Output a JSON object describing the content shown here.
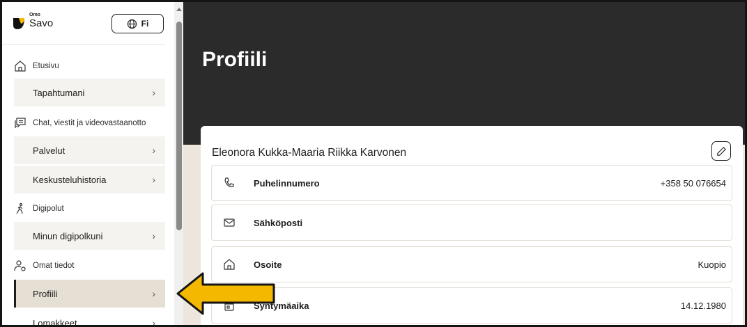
{
  "logo": {
    "small": "Omo",
    "main": "Savo"
  },
  "language_button": {
    "label": "Fi"
  },
  "sidebar": {
    "sections": [
      {
        "label": "Etusivu",
        "icon": "home-icon"
      },
      {
        "label": "Chat, viestit ja videovastaanotto",
        "icon": "chat-icon"
      },
      {
        "label": "Digipolut",
        "icon": "walking-person-icon"
      },
      {
        "label": "Omat tiedot",
        "icon": "user-settings-icon"
      }
    ],
    "items": [
      {
        "label": "Tapahtumani",
        "chevron": "›"
      },
      {
        "label": "Palvelut",
        "chevron": "›"
      },
      {
        "label": "Keskusteluhistoria",
        "chevron": "›"
      },
      {
        "label": "Minun digipolkuni",
        "chevron": "›"
      },
      {
        "label": "Profiili",
        "chevron": "›"
      },
      {
        "label": "Lomakkeet",
        "chevron": "›"
      }
    ]
  },
  "main": {
    "title": "Profiili",
    "name": "Eleonora Kukka-Maaria Riikka Karvonen",
    "rows": [
      {
        "label": "Puhelinnumero",
        "value": "+358 50 076654",
        "icon": "phone-icon"
      },
      {
        "label": "Sähköposti",
        "value": "",
        "icon": "mail-icon"
      },
      {
        "label": "Osoite",
        "value": "Kuopio",
        "icon": "home-icon"
      },
      {
        "label": "Syntymäaika",
        "value": "14.12.1980",
        "icon": "calendar-icon"
      }
    ]
  },
  "colors": {
    "hero": "#2b2b2b",
    "active_nav": "#e6dfd4",
    "arrow": "#f5b800",
    "page_bg": "#ede6dc"
  }
}
